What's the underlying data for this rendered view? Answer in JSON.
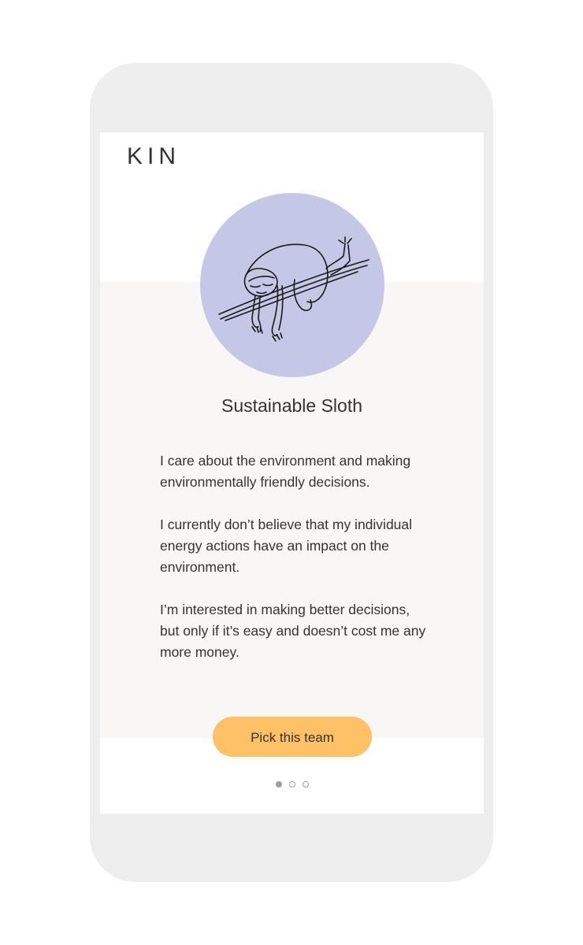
{
  "app": {
    "logo": "KIN"
  },
  "team": {
    "title": "Sustainable Sloth",
    "illustration_icon": "sloth-on-branch-icon",
    "illustration_bg_color": "#c4c8e6",
    "paragraphs": [
      "I care about the environment and making environmentally friendly decisions.",
      "I currently don’t believe that my individual energy actions have an impact on the environment.",
      "I’m interested in making better decisions, but only if it’s easy and doesn’t cost me any more money."
    ]
  },
  "cta": {
    "label": "Pick this team",
    "color": "#fec165"
  },
  "pager": {
    "count": 3,
    "active_index": 0
  }
}
